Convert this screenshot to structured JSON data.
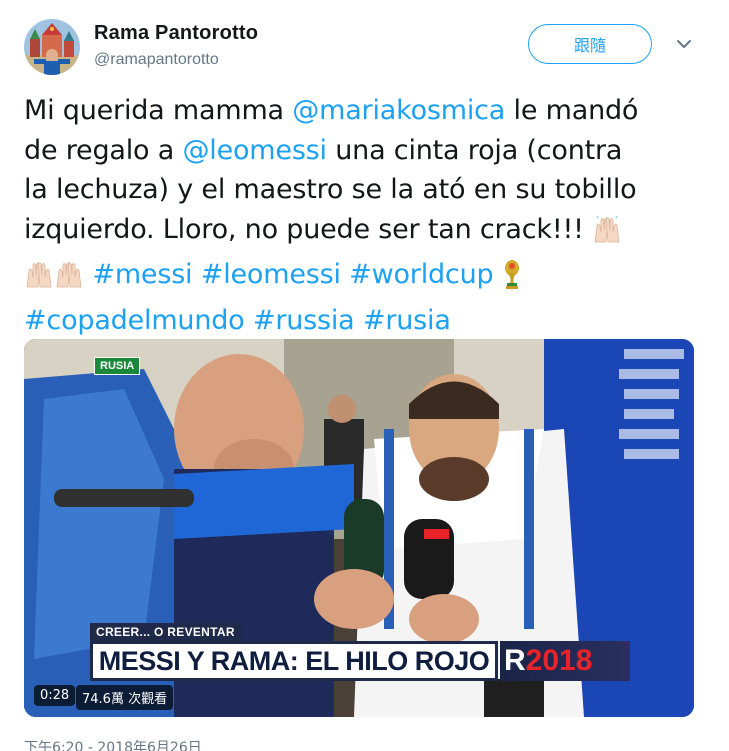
{
  "author": {
    "display_name": "Rama Pantorotto",
    "handle": "@ramapantorotto"
  },
  "follow_button": {
    "label": "跟隨"
  },
  "caret_icon": "chevron-down-icon",
  "tweet": {
    "line1_pre": "Mi querida mamma ",
    "mention1": "@mariakosmica",
    "line1_post": " le mandó",
    "line2_pre": "de regalo a ",
    "mention2": "@leomessi",
    "line2_post": " una cinta roja (contra",
    "line3": "la lechuza) y el maestro se la ató en su tobillo",
    "line4": "izquierdo. Lloro, no puede ser tan crack!!!",
    "hashtags_line5": [
      "#messi",
      "#leomessi",
      "#worldcup"
    ],
    "hashtags_line6": [
      "#copadelmundo",
      "#russia",
      "#rusia"
    ],
    "emojis": [
      "raising-hands-icon",
      "raising-hands-icon",
      "raising-hands-icon",
      "world-cup-trophy-icon"
    ]
  },
  "media": {
    "corner_tag": "RUSIA",
    "lower_third_top": "CREER... O REVENTAR",
    "lower_third_main": "MESSI Y RAMA: EL HILO ROJO",
    "brand_r": "R",
    "brand_year": "2018",
    "duration": "0:28",
    "views": "74.6萬 次觀看"
  },
  "timestamp": "下午6:20 - 2018年6月26日",
  "colors": {
    "link": "#1da1f2",
    "text": "#14171a",
    "muted": "#657786",
    "brand_red": "#e8232a"
  }
}
